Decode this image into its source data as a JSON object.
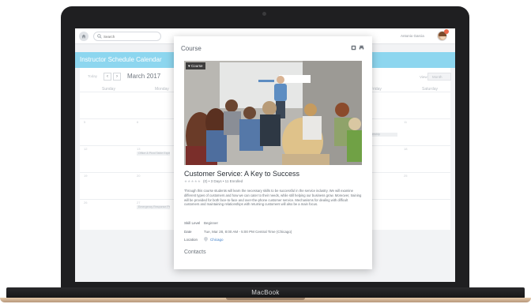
{
  "device": {
    "brand": "MacBook"
  },
  "topbar": {
    "search_placeholder": "Search",
    "user_name": "Antonio Garcia"
  },
  "calendar": {
    "title": "Instructor Schedule Calendar",
    "today_label": "Today",
    "month": "March 2017",
    "view_label": "View",
    "view_value": "Month",
    "weekdays": [
      "Sunday",
      "Monday",
      "Friday",
      "Saturday"
    ],
    "dates": [
      "5",
      "6",
      "10",
      "11",
      "12",
      "13",
      "17",
      "18",
      "19",
      "20",
      "24",
      "25",
      "26",
      "27"
    ],
    "events": [
      "Office & Pivot Table Expert",
      "Emergency Response Procedures",
      "Leadership"
    ]
  },
  "modal": {
    "title": "Course",
    "badge": "Course",
    "course_name": "Customer Service: A Key to Success",
    "rating_count": "(0)",
    "duration": "3 Days",
    "enrolled": "11 Enrolled",
    "description": "Through this course students will learn the necessary skills to be successful in the service industry. We will examine different types of customers and how we can cater to their needs, while still helping our business grow. Moreover, training will be provided for both face-to-face and over-the-phone customer service. Mechanisms for dealing with difficult customers and maintaining relationships with returning customers will also be a main focus.",
    "skill_level_label": "Skill Level",
    "skill_level_value": "Beginner",
    "date_label": "Date",
    "date_value": "Tue, Mar 28, 8:00 AM - 5:00 PM Central Time (Chicago)",
    "location_label": "Location",
    "location_value": "Chicago",
    "contacts_heading": "Contacts"
  },
  "colors": {
    "calendar_header": "#8dd6ef",
    "link": "#3f7fc9",
    "laptop_bezel": "#1f1f21",
    "laptop_base": "#d8bb9b"
  }
}
